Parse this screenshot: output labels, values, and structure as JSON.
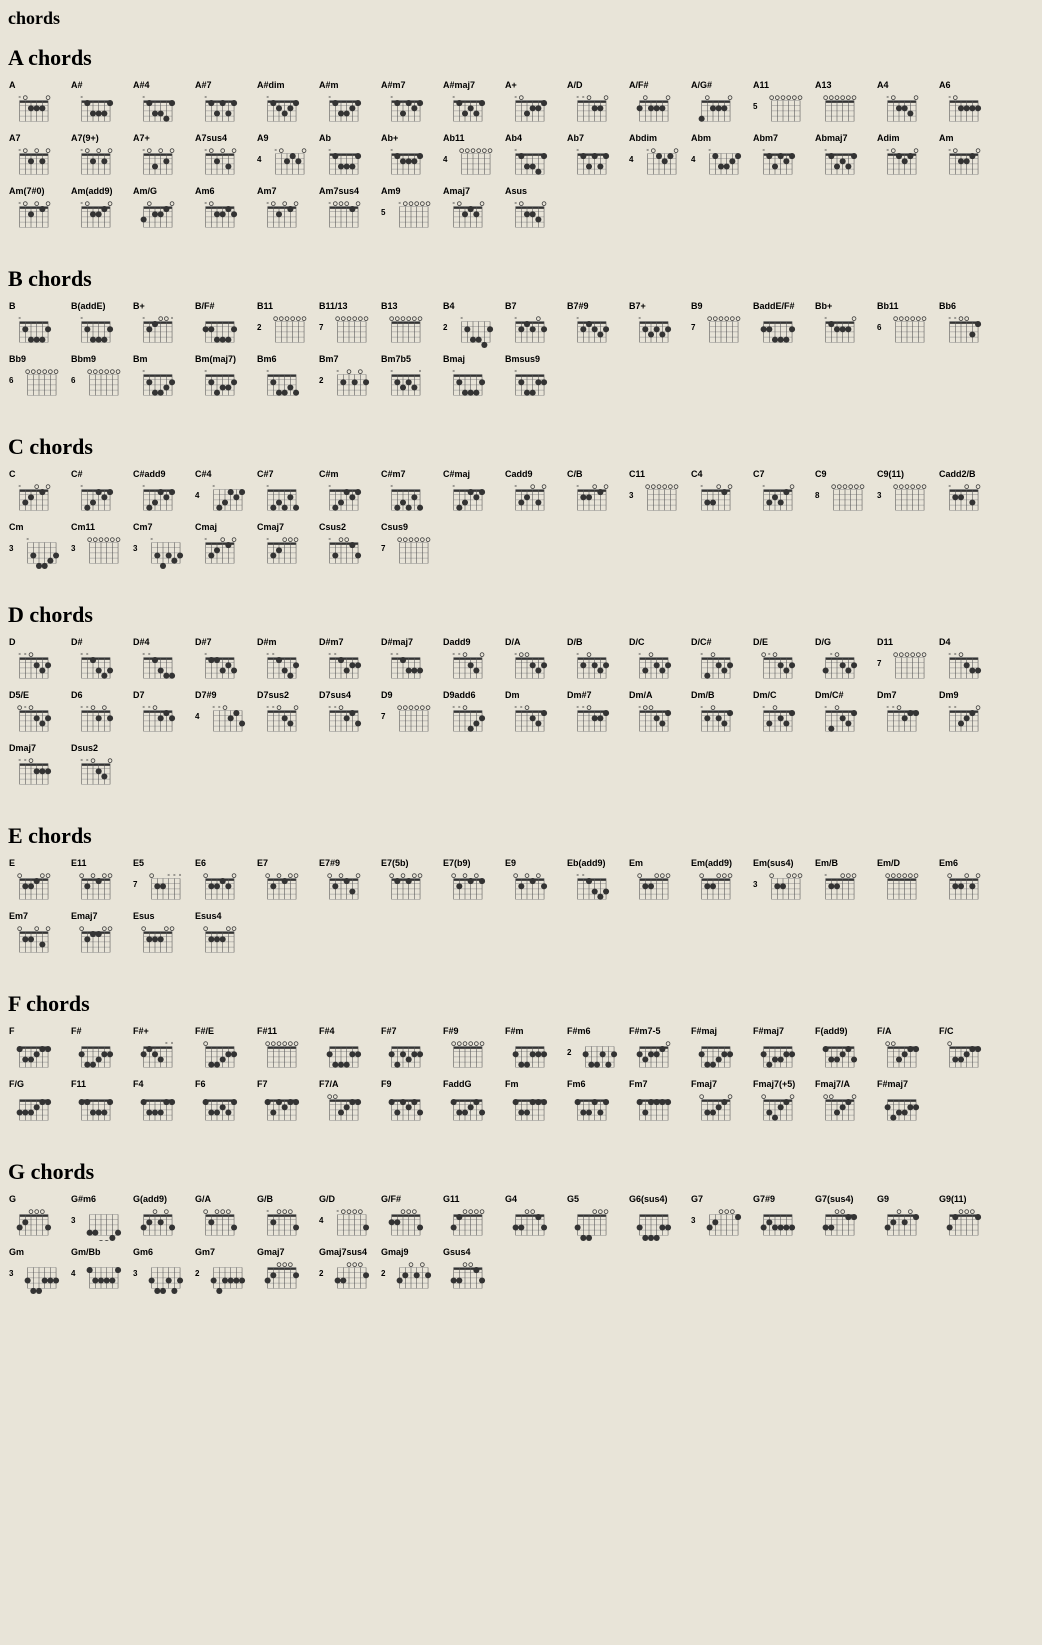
{
  "title": "chords",
  "sections": [
    {
      "letter": "A",
      "label": "A chords"
    },
    {
      "letter": "B",
      "label": "B chords"
    },
    {
      "letter": "C",
      "label": "C chords"
    },
    {
      "letter": "D",
      "label": "D chords"
    },
    {
      "letter": "E",
      "label": "E chords"
    },
    {
      "letter": "F",
      "label": "F chords"
    },
    {
      "letter": "G",
      "label": "G chords"
    }
  ]
}
